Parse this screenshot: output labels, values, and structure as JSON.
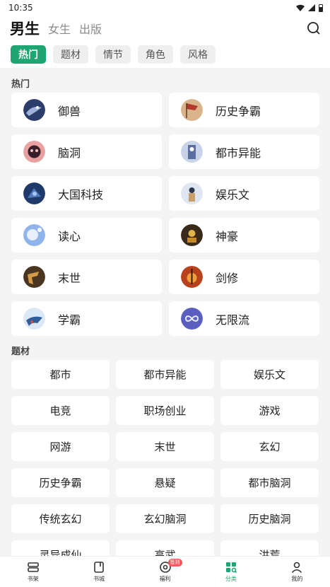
{
  "status": {
    "time": "10:35"
  },
  "header": {
    "tabs": [
      {
        "label": "男生"
      },
      {
        "label": "女生"
      },
      {
        "label": "出版"
      }
    ]
  },
  "categories": [
    {
      "label": "热门"
    },
    {
      "label": "题材"
    },
    {
      "label": "情节"
    },
    {
      "label": "角色"
    },
    {
      "label": "风格"
    }
  ],
  "hot": {
    "title": "热门",
    "items": [
      {
        "label": "御兽"
      },
      {
        "label": "历史争霸"
      },
      {
        "label": "脑洞"
      },
      {
        "label": "都市异能"
      },
      {
        "label": "大国科技"
      },
      {
        "label": "娱乐文"
      },
      {
        "label": "读心"
      },
      {
        "label": "神豪"
      },
      {
        "label": "末世"
      },
      {
        "label": "剑修"
      },
      {
        "label": "学霸"
      },
      {
        "label": "无限流"
      }
    ]
  },
  "topics": {
    "title": "题材",
    "items": [
      {
        "label": "都市"
      },
      {
        "label": "都市异能"
      },
      {
        "label": "娱乐文"
      },
      {
        "label": "电竞"
      },
      {
        "label": "职场创业"
      },
      {
        "label": "游戏"
      },
      {
        "label": "网游"
      },
      {
        "label": "末世"
      },
      {
        "label": "玄幻"
      },
      {
        "label": "历史争霸"
      },
      {
        "label": "悬疑"
      },
      {
        "label": "都市脑洞"
      },
      {
        "label": "传统玄幻"
      },
      {
        "label": "玄幻脑洞"
      },
      {
        "label": "历史脑洞"
      },
      {
        "label": "灵异成仙"
      },
      {
        "label": "高武"
      },
      {
        "label": "洪荒"
      }
    ]
  },
  "nav": {
    "items": [
      {
        "label": "书架"
      },
      {
        "label": "书城"
      },
      {
        "label": "福利",
        "badge": "签到"
      },
      {
        "label": "分类"
      },
      {
        "label": "我的"
      }
    ]
  },
  "colors": {
    "accent": "#1fa56f",
    "badge": "#f05a5a"
  }
}
